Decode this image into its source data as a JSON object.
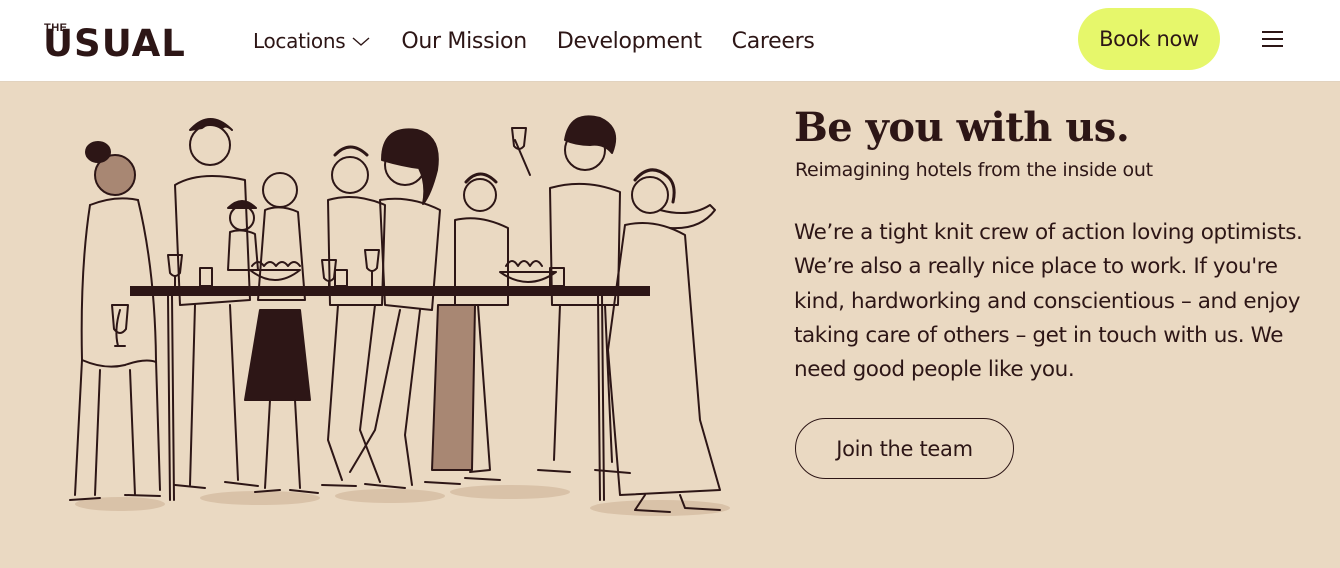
{
  "brand": {
    "logo_small": "THE",
    "logo_main": "USUAL"
  },
  "nav": {
    "items": [
      {
        "label": "Locations",
        "icon": "chevron-down-icon"
      },
      {
        "label": "Our Mission"
      },
      {
        "label": "Development"
      },
      {
        "label": "Careers"
      }
    ],
    "book_label": "Book now",
    "menu_icon": "hamburger-menu-icon"
  },
  "hero": {
    "title": "Be you with us.",
    "subtitle": "Reimagining hotels from the inside out",
    "body": "We’re a tight knit crew of action loving optimists. We’re also a really nice place to work. If you're kind, hardworking and conscientious – and enjoy taking care of others – get in touch with us. We need good people like you.",
    "cta_label": "Join the team"
  },
  "colors": {
    "background": "#ead9c2",
    "header_background": "#ffffff",
    "ink": "#2d1616",
    "book_button": "#e6f76b",
    "illustration_fill": "#a88773"
  }
}
